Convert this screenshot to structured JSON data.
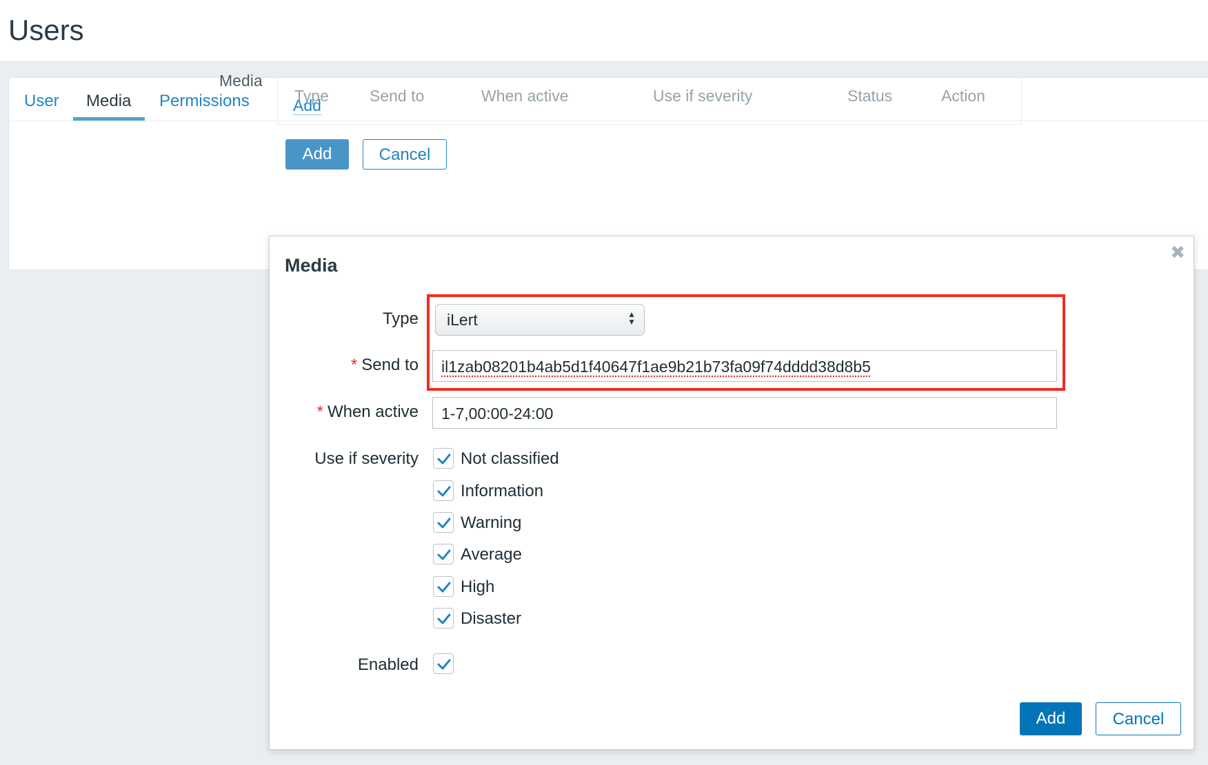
{
  "page": {
    "title": "Users"
  },
  "tabs": [
    {
      "label": "User"
    },
    {
      "label": "Media"
    },
    {
      "label": "Permissions"
    }
  ],
  "media_section": {
    "label": "Media",
    "columns": [
      "Type",
      "Send to",
      "When active",
      "Use if severity",
      "Status",
      "Action"
    ],
    "add_link": "Add",
    "add_button": "Add",
    "cancel_button": "Cancel"
  },
  "modal": {
    "title": "Media",
    "close_icon": "close-icon",
    "type_label": "Type",
    "type_value": "iLert",
    "send_to_label": "Send to",
    "send_to_value": "il1zab08201b4ab5d1f40647f1ae9b21b73fa09f74dddd38d8b5",
    "when_active_label": "When active",
    "when_active_value": "1-7,00:00-24:00",
    "severity_label": "Use if severity",
    "severities": [
      {
        "label": "Not classified",
        "checked": true
      },
      {
        "label": "Information",
        "checked": true
      },
      {
        "label": "Warning",
        "checked": true
      },
      {
        "label": "Average",
        "checked": true
      },
      {
        "label": "High",
        "checked": true
      },
      {
        "label": "Disaster",
        "checked": true
      }
    ],
    "enabled_label": "Enabled",
    "enabled_checked": true,
    "add_button": "Add",
    "cancel_button": "Cancel",
    "required_marker": "*"
  },
  "colors": {
    "link": "#1f85c4",
    "primary_button": "#0275b8",
    "highlight_border": "#f02c1f",
    "required": "#e0332b"
  }
}
